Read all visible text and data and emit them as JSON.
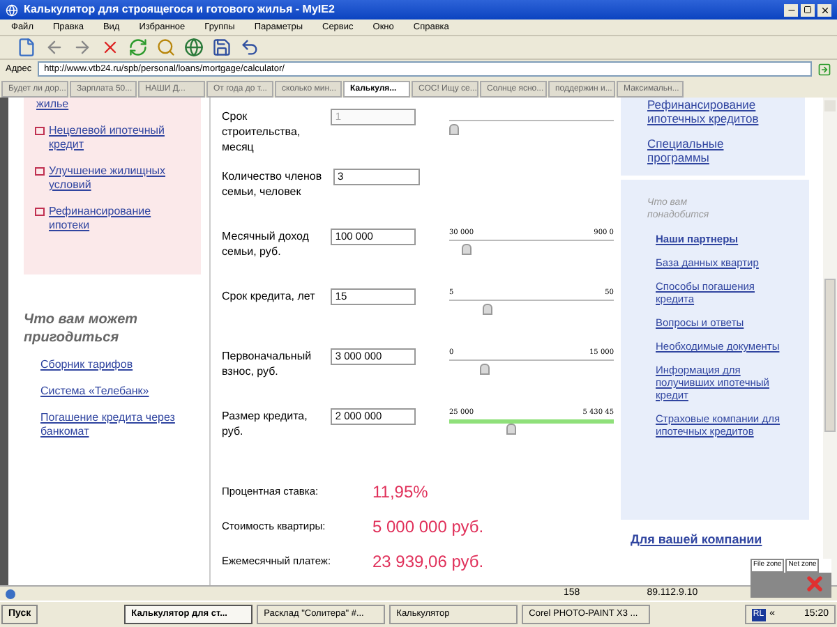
{
  "window": {
    "title": "Калькулятор для строящегося и готового жилья - MyIE2"
  },
  "menu": [
    "Файл",
    "Правка",
    "Вид",
    "Избранное",
    "Группы",
    "Параметры",
    "Сервис",
    "Окно",
    "Справка"
  ],
  "address": {
    "label": "Адрес",
    "url": "http://www.vtb24.ru/spb/personal/loans/mortgage/calculator/"
  },
  "tabs": [
    {
      "label": "Будет ли дор...",
      "selected": false
    },
    {
      "label": "Зарплата 50...",
      "selected": false
    },
    {
      "label": "НАШИ Д...",
      "selected": false
    },
    {
      "label": "От года до т...",
      "selected": false
    },
    {
      "label": "сколько мин...",
      "selected": false
    },
    {
      "label": "Калькуля...",
      "selected": true
    },
    {
      "label": "СОС! Ищу се...",
      "selected": false
    },
    {
      "label": "Солнце ясно...",
      "selected": false
    },
    {
      "label": "поддержин и...",
      "selected": false
    },
    {
      "label": "Максимальн...",
      "selected": false
    }
  ],
  "left_nav": {
    "links": [
      "жилье",
      "Нецелевой ипотечный кредит",
      "Улучшение жилищных условий",
      "Рефинансирование ипотеки"
    ],
    "useful_title": "Что вам может пригодиться",
    "useful_links": [
      "Сборник тарифов",
      "Система «Телебанк»",
      "Погашение кредита через банкомат"
    ]
  },
  "form": {
    "rows": [
      {
        "label": "Срок строительства, месяц",
        "value": "1",
        "disabled": true,
        "slider": {
          "level": 0,
          "highlight": false
        }
      },
      {
        "label": "Количество членов семьи, человек",
        "value": "3",
        "disabled": false
      },
      {
        "label": "Месячный доход семьи, руб.",
        "value": "100 000",
        "disabled": false,
        "slider": {
          "min": "30 000",
          "max": "900 0",
          "level": 0.08,
          "highlight": false
        }
      },
      {
        "label": "Срок кредита, лет",
        "value": "15",
        "disabled": false,
        "slider": {
          "min": "5",
          "max": "50",
          "level": 0.22,
          "highlight": false
        }
      },
      {
        "label": "Первоначальный взнос, руб.",
        "value": "3 000 000",
        "disabled": false,
        "slider": {
          "min": "0",
          "max": "15 000",
          "level": 0.2,
          "highlight": false
        }
      },
      {
        "label": "Размер кредита, руб.",
        "value": "2 000 000",
        "disabled": false,
        "slider": {
          "min": "25 000",
          "max": "5 430 45",
          "level": 0.37,
          "highlight": true
        }
      }
    ],
    "results": [
      {
        "label": "Процентная ставка:",
        "value": "11,95%"
      },
      {
        "label": "Стоимость квартиры:",
        "value": "5 000 000 руб."
      },
      {
        "label": "Ежемесячный платеж:",
        "value": "23 939,06 руб."
      }
    ]
  },
  "right_nav": {
    "top_links": [
      "Рефинансирование ипотечных кредитов",
      "Специальные программы"
    ],
    "needs_title": "Что вам понадобится",
    "needs_links": [
      {
        "label": "Наши партнеры",
        "selected": true
      },
      {
        "label": "База данных квартир",
        "selected": false
      },
      {
        "label": "Способы погашения кредита",
        "selected": false
      },
      {
        "label": "Вопросы и ответы",
        "selected": false
      },
      {
        "label": "Необходимые документы",
        "selected": false
      },
      {
        "label": "Информация для получивших ипотечный кредит",
        "selected": false
      },
      {
        "label": "Страховые компании для ипотечных кредитов",
        "selected": false
      }
    ],
    "company_link": "Для вашей компании"
  },
  "zone_widget": {
    "file_zone": "File zone",
    "net_zone": "Net zone"
  },
  "status_bar": {
    "count": "158",
    "ip": "89.112.9.10"
  },
  "taskbar": {
    "start": "Пуск",
    "tasks": [
      {
        "label": "Калькулятор для ст...",
        "selected": true
      },
      {
        "label": "Расклад \"Солитера\" #...",
        "selected": false
      },
      {
        "label": "Калькулятор",
        "selected": false
      },
      {
        "label": "Corel PHOTO-PAINT X3 ...",
        "selected": false
      }
    ],
    "lang": "RL",
    "tray_arrows": "«",
    "clock": "15:20"
  }
}
